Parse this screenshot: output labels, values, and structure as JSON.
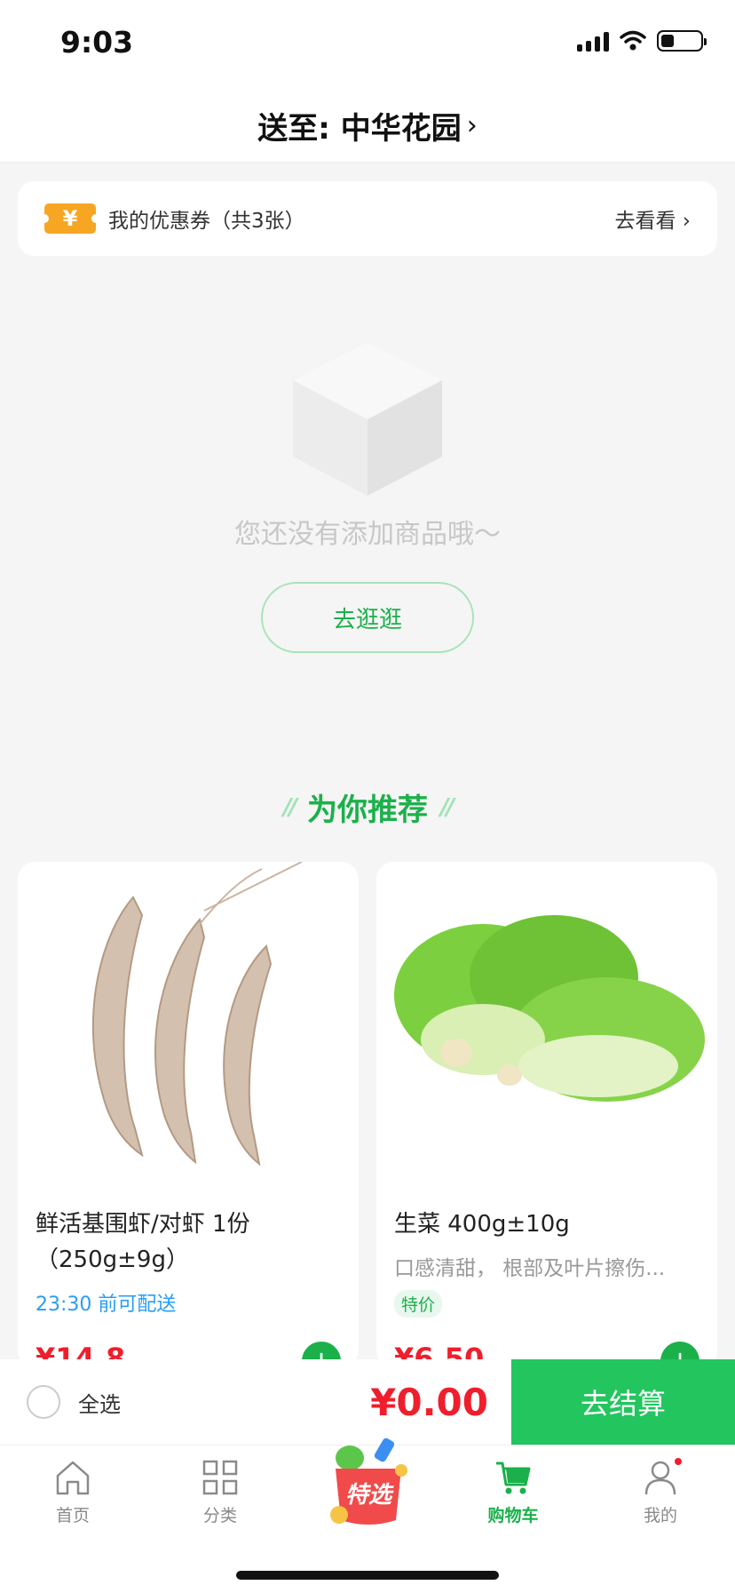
{
  "status_bar": {
    "time": "9:03"
  },
  "header": {
    "address": "送至: 中华花园"
  },
  "coupon": {
    "badge": "¥",
    "text": "我的优惠券（共3张）",
    "link": "去看看"
  },
  "empty": {
    "message": "您还没有添加商品哦～",
    "button": "去逛逛"
  },
  "recommend": {
    "title": "为你推荐"
  },
  "products": [
    {
      "name": "鲜活基围虾/对虾 1份（250g±9g）",
      "delivery": "23:30 前可配送",
      "price": "¥14.8"
    },
    {
      "name": "生菜 400g±10g",
      "desc": "口感清甜， 根部及叶片擦伤...",
      "tag": "特价",
      "price": "¥6.50"
    }
  ],
  "checkout": {
    "select_all": "全选",
    "total": "¥0.00",
    "button": "去结算"
  },
  "tabbar": {
    "items": [
      {
        "label": "首页",
        "icon": "home-icon"
      },
      {
        "label": "分类",
        "icon": "grid-icon"
      },
      {
        "label": "特选",
        "icon": "special-bag-icon"
      },
      {
        "label": "购物车",
        "icon": "cart-icon"
      },
      {
        "label": "我的",
        "icon": "person-icon"
      }
    ]
  },
  "colors": {
    "primary": "#1cb04b",
    "price": "#f01e2c",
    "checkout_button": "#22c55e",
    "delivery": "#2a9df4"
  }
}
